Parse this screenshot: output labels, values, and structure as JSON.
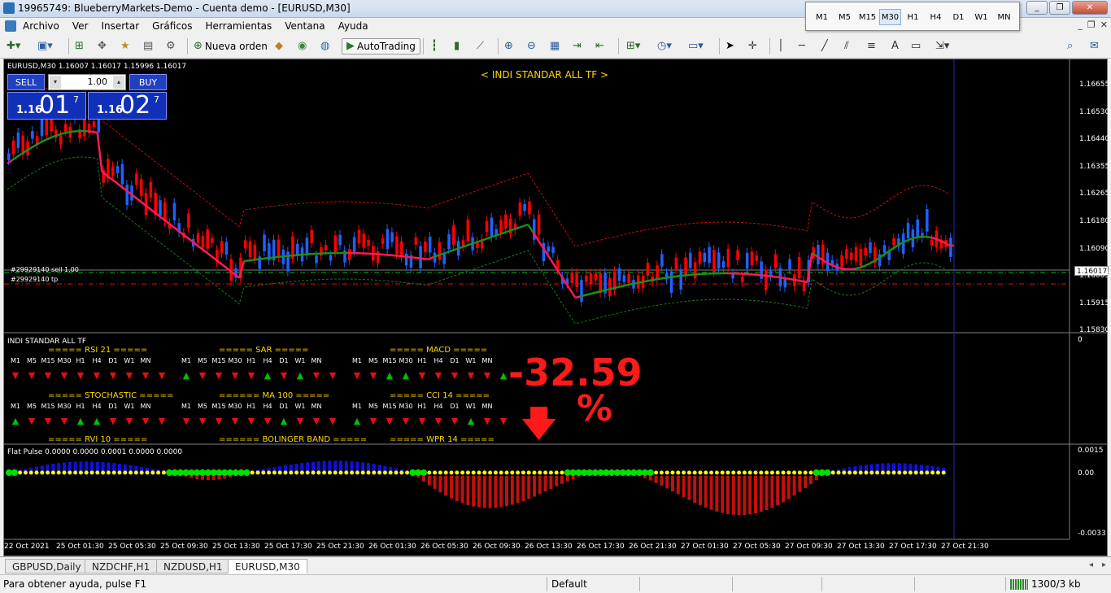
{
  "window": {
    "title": "19965749: BlueberryMarkets-Demo - Cuenta demo - [EURUSD,M30]",
    "controls": [
      "_",
      "❐",
      "✕"
    ]
  },
  "timeframes": [
    "M1",
    "M5",
    "M15",
    "M30",
    "H1",
    "H4",
    "D1",
    "W1",
    "MN"
  ],
  "active_timeframe": "M30",
  "menu": [
    "Archivo",
    "Ver",
    "Insertar",
    "Gráficos",
    "Herramientas",
    "Ventana",
    "Ayuda"
  ],
  "toolbar": {
    "new_order": "Nueva orden",
    "autotrading": "AutoTrading"
  },
  "chart": {
    "header": "EURUSD,M30  1.16007 1.16017 1.15996 1.16017",
    "indicator_title": "< INDI STANDAR ALL TF >",
    "one_click": {
      "sell": "SELL",
      "buy": "BUY",
      "lot": "1.00",
      "sell_prefix": "1.16",
      "sell_big": "01",
      "sell_sup": "7",
      "buy_prefix": "1.16",
      "buy_big": "02",
      "buy_sup": "7"
    },
    "trade_sell": "#29929140 sell 1.00",
    "trade_tp": "#29929140 tp",
    "current_price": "1.16017",
    "price_axis": [
      "1.16655",
      "1.16530",
      "1.16440",
      "1.16355",
      "1.16265",
      "1.16180",
      "1.16090",
      "1.16005",
      "1.15915",
      "1.15830"
    ],
    "colors": {
      "bull": "#2060ff",
      "bear": "#ff0000",
      "ma_green": "#1a8f1a",
      "ma_red": "#ff1a55",
      "env_red": "#c01010",
      "env_green": "#1a7a1a",
      "text_yellow": "#ffd700"
    }
  },
  "indicator_panel": {
    "name": "INDI STANDAR ALL TF",
    "axis_zero": "0",
    "groups_row1": [
      {
        "title": "===== RSI 21 =====",
        "arrows": [
          "d",
          "d",
          "d",
          "d",
          "d",
          "d",
          "d",
          "d",
          "d",
          "d"
        ]
      },
      {
        "title": "===== SAR =====",
        "arrows": [
          "u",
          "d",
          "d",
          "d",
          "d",
          "u",
          "d",
          "u",
          "d",
          "d"
        ]
      },
      {
        "title": "===== MACD =====",
        "arrows": [
          "d",
          "d",
          "u",
          "u",
          "d",
          "d",
          "d",
          "d",
          "d",
          "u"
        ]
      }
    ],
    "groups_row2": [
      {
        "title": "===== STOCHASTIC =====",
        "arrows": [
          "u",
          "d",
          "d",
          "d",
          "u",
          "u",
          "d",
          "d",
          "d",
          "d"
        ]
      },
      {
        "title": "====== MA 100 =====",
        "arrows": [
          "d",
          "d",
          "d",
          "d",
          "d",
          "d",
          "u",
          "d",
          "d",
          "d"
        ]
      },
      {
        "title": "===== CCI 14 =====",
        "arrows": [
          "u",
          "d",
          "d",
          "d",
          "d",
          "d",
          "d",
          "u",
          "d",
          "d"
        ]
      }
    ],
    "groups_row3": [
      "===== RVI 10 =====",
      "====== BOLINGER BAND =====",
      "===== WPR 14 ====="
    ],
    "percent": "-32.59",
    "percent_sign": "%",
    "percent_arrow": "🡇"
  },
  "flat_pulse": {
    "label": "Flat Pulse 0.0000 0.0000 0.0001 0.0000 0.0000",
    "axis": [
      "0.0015",
      "0.00",
      "-0.0033"
    ]
  },
  "time_axis": [
    "22 Oct 2021",
    "25 Oct 01:30",
    "25 Oct 05:30",
    "25 Oct 09:30",
    "25 Oct 13:30",
    "25 Oct 17:30",
    "25 Oct 21:30",
    "26 Oct 01:30",
    "26 Oct 05:30",
    "26 Oct 09:30",
    "26 Oct 13:30",
    "26 Oct 17:30",
    "26 Oct 21:30",
    "27 Oct 01:30",
    "27 Oct 05:30",
    "27 Oct 09:30",
    "27 Oct 13:30",
    "27 Oct 17:30",
    "27 Oct 21:30"
  ],
  "tabs": [
    "GBPUSD,Daily",
    "NZDCHF,H1",
    "NZDUSD,H1",
    "EURUSD,M30"
  ],
  "active_tab": "EURUSD,M30",
  "status": {
    "help": "Para obtener ayuda, pulse F1",
    "profile": "Default",
    "traffic": "1300/3 kb"
  }
}
